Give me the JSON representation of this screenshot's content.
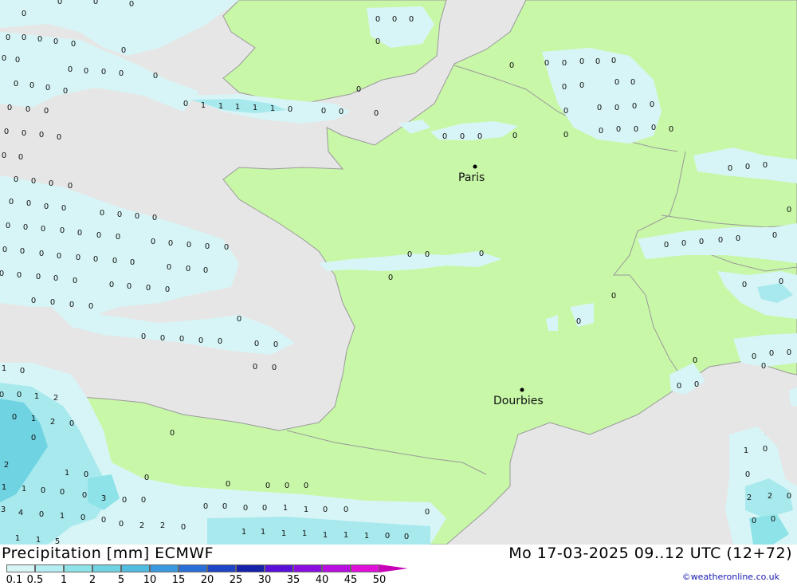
{
  "map": {
    "cities": [
      {
        "name": "Paris"
      },
      {
        "name": "Dourbies"
      }
    ]
  },
  "colors": {
    "sea": "#e6e6e6",
    "land": "#c8f7a8",
    "border": "#9a9a9a",
    "precip_light": "#d7f5f6",
    "precip_medium": "#a8e9ee"
  },
  "footer": {
    "title": "Precipitation [mm] ECMWF",
    "date": "Mo 17-03-2025 09..12 UTC (12+72)",
    "credit": "©weatheronline.co.uk"
  },
  "legend": {
    "labels": [
      "0.1",
      "0.5",
      "1",
      "2",
      "5",
      "10",
      "15",
      "20",
      "25",
      "30",
      "35",
      "40",
      "45",
      "50"
    ],
    "colors": [
      "#d7f5f6",
      "#b4eef2",
      "#8ee3e8",
      "#6fd3e2",
      "#50bde0",
      "#3a9ae0",
      "#2a6ed8",
      "#1e44c8",
      "#1421a8",
      "#5a10d8",
      "#8a0ee0",
      "#b80ee0",
      "#e010d8",
      "#c800b8"
    ]
  }
}
